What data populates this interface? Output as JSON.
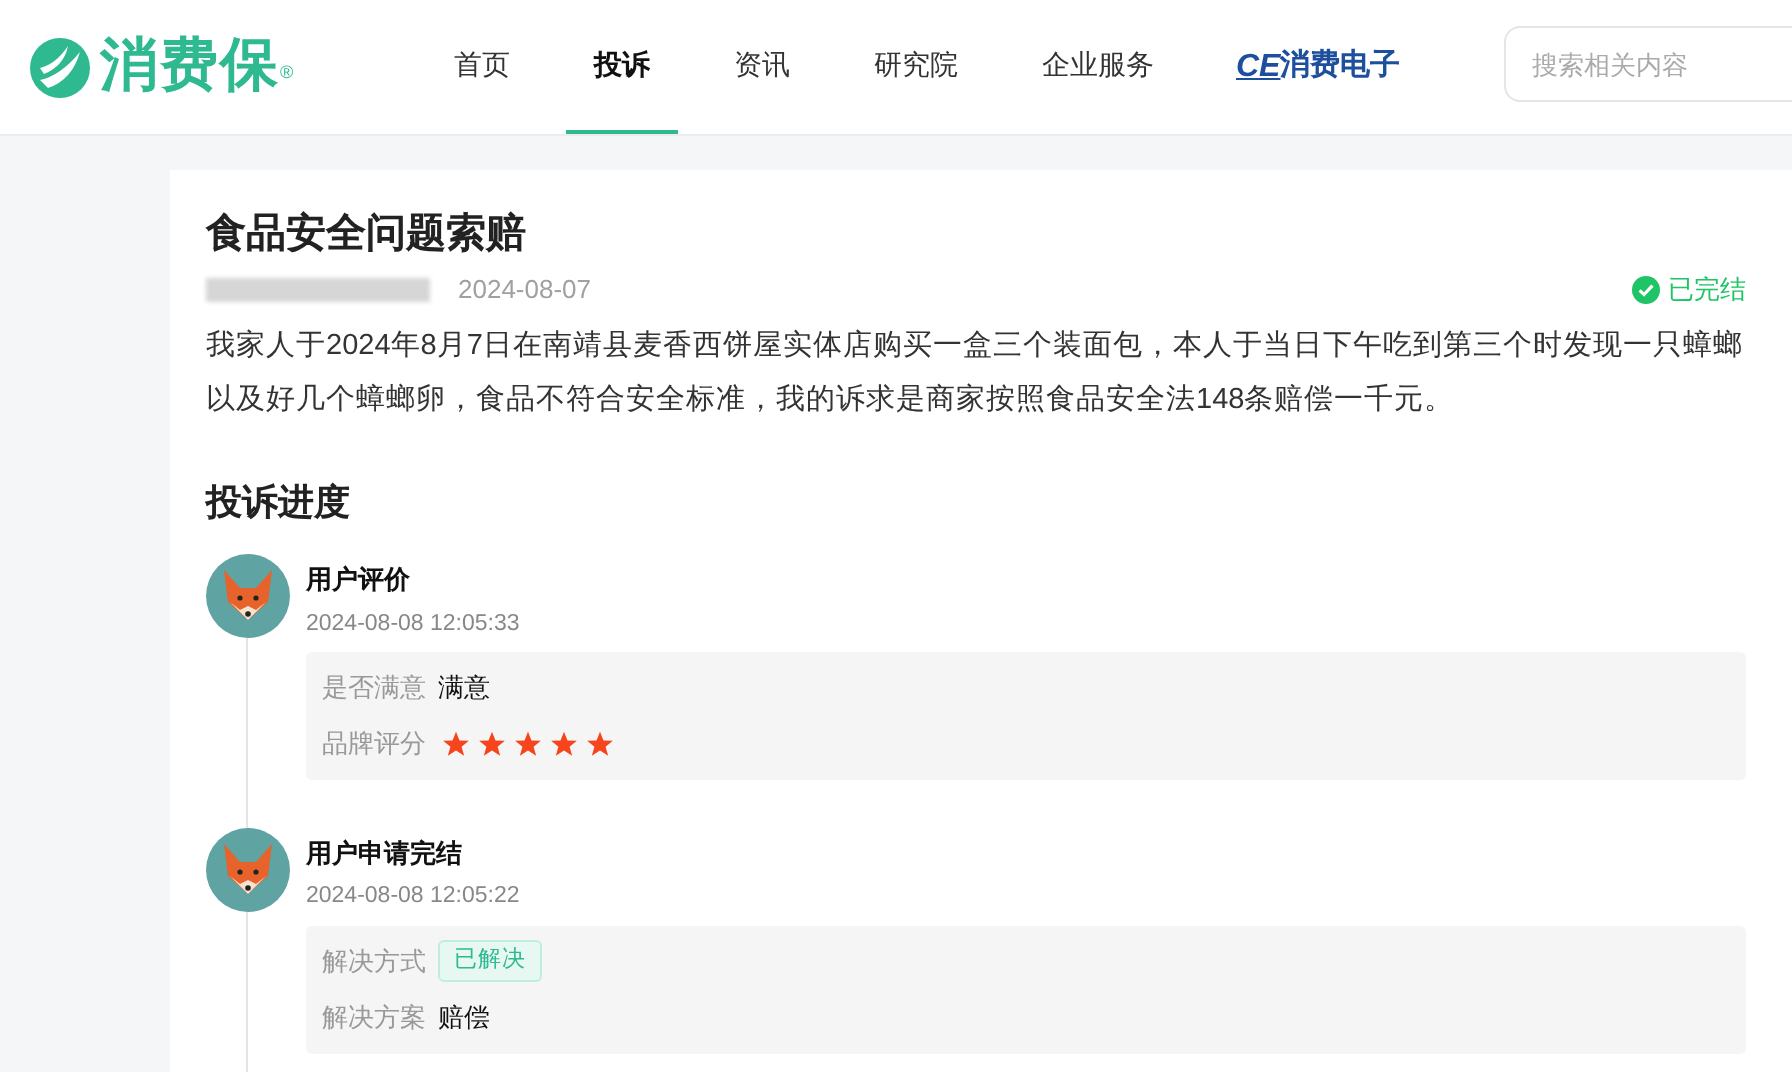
{
  "header": {
    "logo": {
      "text": "消费保",
      "mark": "®"
    },
    "nav": [
      {
        "label": "首页",
        "selected": false
      },
      {
        "label": "投诉",
        "selected": true
      },
      {
        "label": "资讯",
        "selected": false
      },
      {
        "label": "研究院",
        "selected": false
      },
      {
        "label": "企业服务",
        "selected": false
      }
    ],
    "partner_logo": {
      "mark": "CE",
      "text": "消费电子"
    },
    "search": {
      "placeholder": "搜索相关内容"
    }
  },
  "complaint": {
    "title": "食品安全问题索赔",
    "date": "2024-08-07",
    "status": "已完结",
    "description": "我家人于2024年8月7日在南靖县麦香西饼屋实体店购买一盒三个装面包，本人于当日下午吃到第三个时发现一只蟑螂以及好几个蟑螂卵，食品不符合安全标准，我的诉求是商家按照食品安全法148条赔偿一千元。"
  },
  "progress": {
    "title": "投诉进度",
    "events": [
      {
        "title": "用户评价",
        "time": "2024-08-08 12:05:33",
        "fields": [
          {
            "kind": "text",
            "label": "是否满意",
            "value": "满意"
          },
          {
            "kind": "stars",
            "label": "品牌评分",
            "stars": 5
          }
        ]
      },
      {
        "title": "用户申请完结",
        "time": "2024-08-08 12:05:22",
        "fields": [
          {
            "kind": "tag",
            "label": "解决方式",
            "value": "已解决"
          },
          {
            "kind": "text",
            "label": "解决方案",
            "value": "赔偿"
          }
        ]
      }
    ]
  }
}
